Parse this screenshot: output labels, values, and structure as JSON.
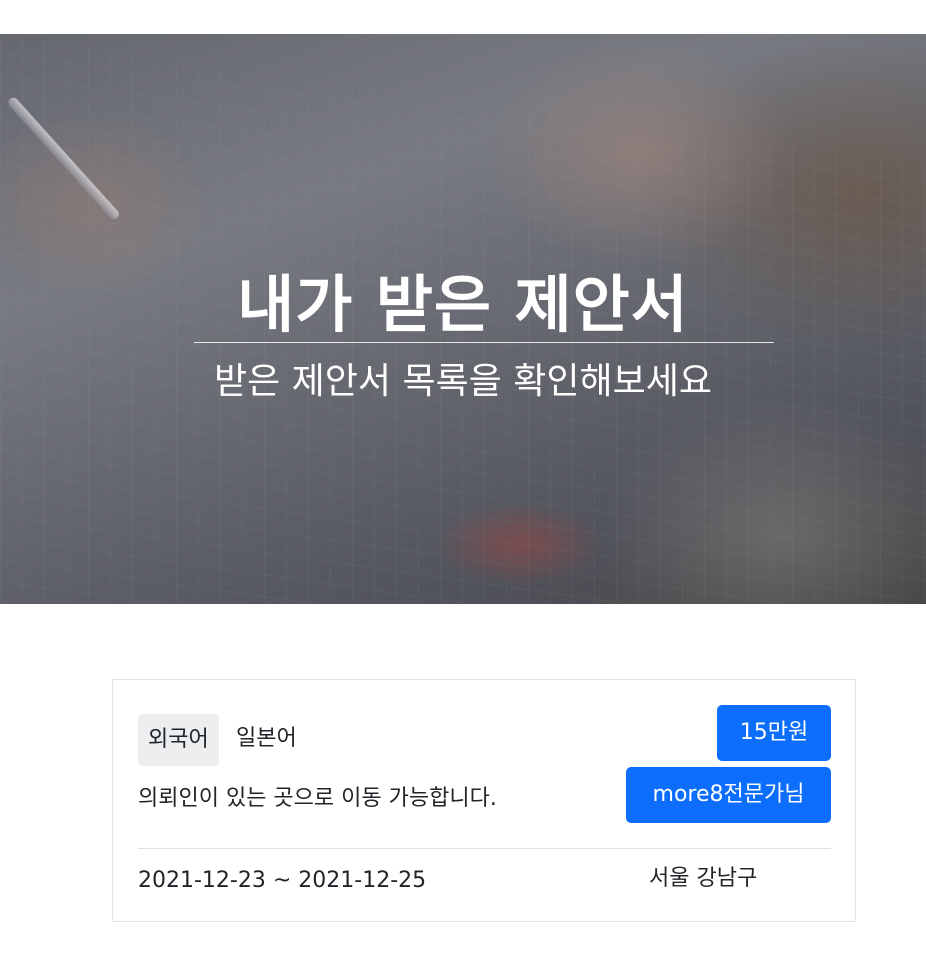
{
  "hero": {
    "title": "내가 받은 제안서",
    "subtitle": "받은 제안서 목록을 확인해보세요"
  },
  "proposal": {
    "category_badge": "외국어",
    "language": "일본어",
    "description": "의뢰인이 있는 곳으로 이동 가능합니다.",
    "price_label": "15만원",
    "expert_label": "more8전문가님",
    "dates": "2021-12-23 ~ 2021-12-25",
    "location": "서울 강남구"
  },
  "colors": {
    "primary_button": "#0d6efd",
    "badge_background": "#eceef0"
  }
}
